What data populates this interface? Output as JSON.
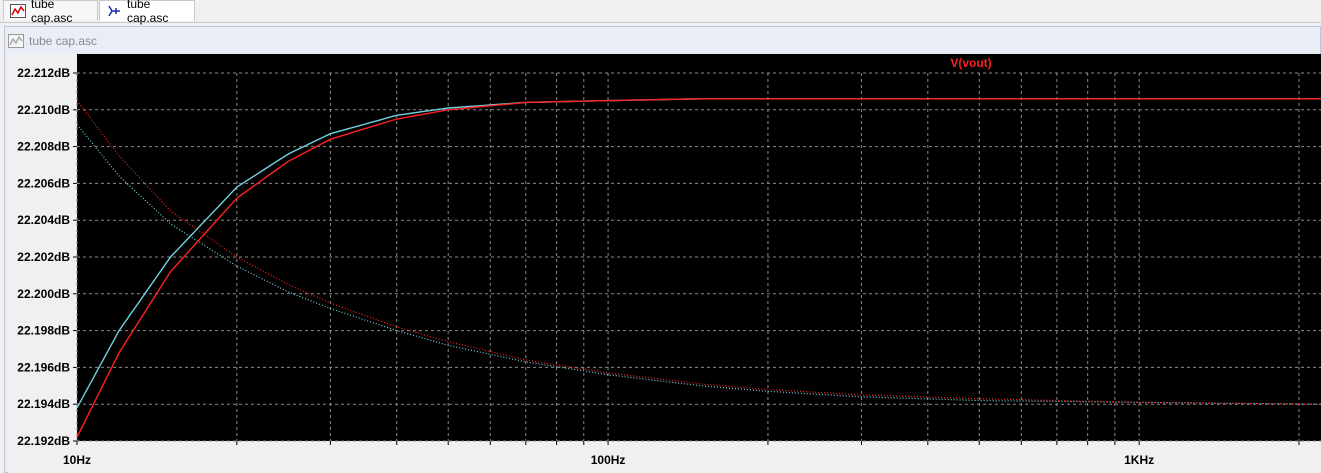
{
  "tabs": [
    {
      "label": "tube cap.asc",
      "icon": "waveform-icon"
    },
    {
      "label": "tube cap.asc",
      "icon": "schematic-icon"
    }
  ],
  "window": {
    "title": "tube cap.asc",
    "icon": "waveform-icon"
  },
  "colors": {
    "plot_bg": "#000000",
    "grid": "#8a8a8a",
    "red": "#ff2020",
    "cyan": "#6fd3e0",
    "legend": "#ff2020"
  },
  "chart_data": {
    "type": "line",
    "x_scale": "log",
    "xlim": [
      10,
      2200
    ],
    "ylim": [
      22.192,
      22.212
    ],
    "y_ticks": [
      "22.212dB",
      "22.210dB",
      "22.208dB",
      "22.206dB",
      "22.204dB",
      "22.202dB",
      "22.200dB",
      "22.198dB",
      "22.196dB",
      "22.194dB",
      "22.192dB"
    ],
    "y_tick_values": [
      22.212,
      22.21,
      22.208,
      22.206,
      22.204,
      22.202,
      22.2,
      22.198,
      22.196,
      22.194,
      22.192
    ],
    "x_ticks": [
      "10Hz",
      "100Hz",
      "1KHz"
    ],
    "x_tick_values": [
      10,
      100,
      1000
    ],
    "grid": true,
    "legend": "V(vout)",
    "series": [
      {
        "name": "V(vout)",
        "color": "red",
        "style": "solid",
        "x": [
          10,
          12,
          15,
          20,
          25,
          30,
          40,
          50,
          70,
          100,
          150,
          200,
          300,
          500,
          1000,
          2200
        ],
        "y": [
          22.1922,
          22.1968,
          22.2012,
          22.2052,
          22.2072,
          22.2084,
          22.2095,
          22.21,
          22.2104,
          22.2105,
          22.2106,
          22.2106,
          22.2106,
          22.2106,
          22.2106,
          22.2106
        ]
      },
      {
        "color": "cyan",
        "style": "solid",
        "x": [
          10,
          12,
          15,
          20,
          25,
          30,
          40,
          50,
          70,
          100,
          150,
          200,
          300,
          500,
          1000,
          2200
        ],
        "y": [
          22.1938,
          22.198,
          22.202,
          22.2058,
          22.2076,
          22.2087,
          22.2097,
          22.2101,
          22.2104,
          22.2105,
          22.2106,
          22.2106,
          22.2106,
          22.2106,
          22.2106,
          22.2106
        ]
      },
      {
        "color": "red",
        "style": "dotted",
        "x": [
          10,
          12,
          15,
          20,
          25,
          30,
          40,
          50,
          70,
          100,
          150,
          200,
          300,
          500,
          1000,
          2200
        ],
        "y": [
          22.2105,
          22.2075,
          22.2045,
          22.202,
          22.2005,
          22.1995,
          22.1982,
          22.1974,
          22.1964,
          22.1957,
          22.1951,
          22.1948,
          22.1945,
          22.1943,
          22.1941,
          22.194
        ]
      },
      {
        "color": "cyan",
        "style": "dotted",
        "x": [
          10,
          12,
          15,
          20,
          25,
          30,
          40,
          50,
          70,
          100,
          150,
          200,
          300,
          500,
          1000,
          2200
        ],
        "y": [
          22.2092,
          22.2064,
          22.2038,
          22.2015,
          22.2001,
          22.1992,
          22.198,
          22.1972,
          22.1963,
          22.1956,
          22.195,
          22.1947,
          22.1944,
          22.1942,
          22.1941,
          22.194
        ]
      }
    ]
  }
}
